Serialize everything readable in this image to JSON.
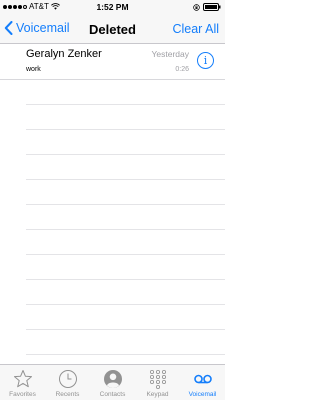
{
  "status_bar": {
    "carrier": "AT&T",
    "time": "1:52 PM",
    "signal_bars": 4,
    "signal_total": 5
  },
  "nav": {
    "back_label": "Voicemail",
    "title": "Deleted",
    "action_label": "Clear All"
  },
  "voicemails": [
    {
      "name": "Geralyn Zenker",
      "label": "work",
      "date": "Yesterday",
      "duration": "0:26"
    }
  ],
  "tabs": [
    {
      "label": "Favorites",
      "icon": "star-icon",
      "active": false
    },
    {
      "label": "Recents",
      "icon": "clock-icon",
      "active": false
    },
    {
      "label": "Contacts",
      "icon": "person-icon",
      "active": false
    },
    {
      "label": "Keypad",
      "icon": "keypad-icon",
      "active": false
    },
    {
      "label": "Voicemail",
      "icon": "voicemail-icon",
      "active": true
    }
  ],
  "colors": {
    "accent": "#147efb",
    "inactive": "#929292",
    "bar_background": "#f7f7f7"
  }
}
